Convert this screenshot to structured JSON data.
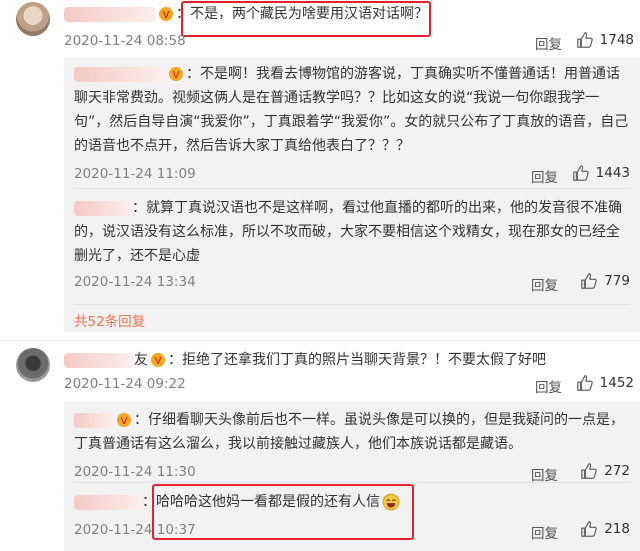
{
  "colors": {
    "highlight": "#e0232d",
    "link": "#eb7350",
    "reply_bg": "#f2f2f2"
  },
  "comments": [
    {
      "text": "：不是，两个藏民为啥要用汉语对话啊？",
      "time": "2020-11-24 08:58",
      "reply_label": "回复",
      "likes": "1748",
      "replies": [
        {
          "text": "：不是啊！我看去博物馆的游客说，丁真确实听不懂普通话！用普通话聊天非常费劲。视频这俩人是在普通话教学吗？？比如这女的说“我说一句你跟我学一句”，然后自导自演“我爱你”，丁真跟着学“我爱你”。女的就只公布了丁真放的语音，自己的语音也不点开，然后告诉大家丁真给他表白了？？？",
          "time": "2020-11-24 11:09",
          "reply_label": "回复",
          "likes": "1443"
        },
        {
          "text": "：就算丁真说汉语也不是这样啊，看过他直播的都听的出来，他的发音很不准确的，说汉语没有这么标准，所以不攻而破，大家不要相信这个戏精女，现在那女的已经全删光了，还不是心虚",
          "time": "2020-11-24 13:34",
          "reply_label": "回复",
          "likes": "779"
        }
      ],
      "more_replies": "共52条回复"
    },
    {
      "text": "：拒绝了还拿我们丁真的照片当聊天背景？！不要太假了好吧",
      "name_suffix": "友",
      "time": "2020-11-24 09:22",
      "reply_label": "回复",
      "likes": "1452",
      "replies": [
        {
          "text": "：仔细看聊天头像前后也不一样。虽说头像是可以换的，但是我疑问的一点是，丁真普通话有这么溜么，我以前接触过藏族人，他们本族说话都是藏语。",
          "time": "2020-11-24 11:30",
          "reply_label": "回复",
          "likes": "272"
        },
        {
          "text": "：哈哈哈这他妈一看都是假的还有人信",
          "time": "2020-11-24 10:37",
          "reply_label": "回复",
          "likes": "218"
        }
      ]
    }
  ]
}
